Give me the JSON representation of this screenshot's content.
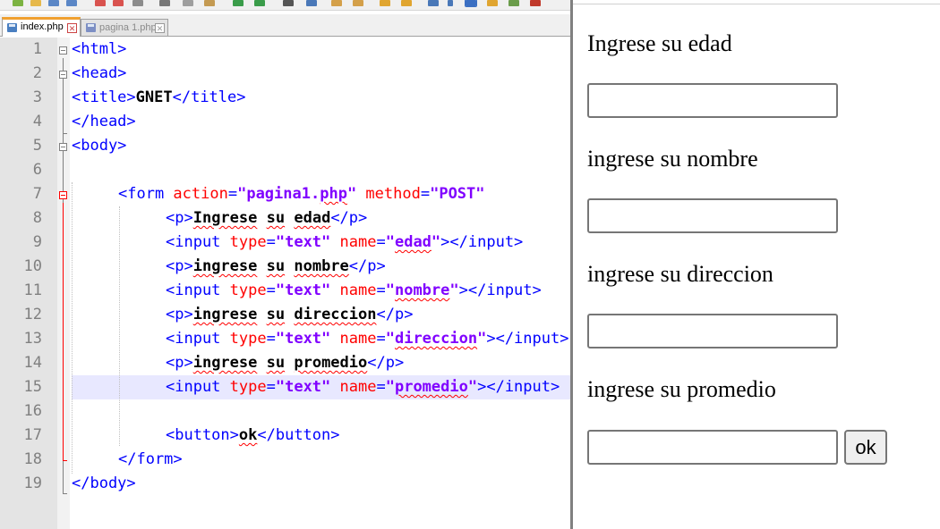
{
  "editor": {
    "tabs": [
      {
        "label": "index.php",
        "active": true
      },
      {
        "label": "pagina 1.php",
        "active": false
      }
    ],
    "close_glyph": "✕",
    "line_numbers": [
      "1",
      "2",
      "3",
      "4",
      "5",
      "6",
      "7",
      "8",
      "9",
      "10",
      "11",
      "12",
      "13",
      "14",
      "15",
      "16",
      "17",
      "18",
      "19"
    ],
    "current_line": "15",
    "code": {
      "l1_tag": "<html>",
      "l2_tag": "<head>",
      "l3_open": "<title>",
      "l3_text": "GNET",
      "l3_close": "</title>",
      "l4_tag": "</head>",
      "l5_tag": "<body>",
      "l7_open": "<form",
      "l7_attr1": " action",
      "l7_eq1": "=",
      "l7_val1a": "\"pagina1.",
      "l7_val1b": "php",
      "l7_val1c": "\"",
      "l7_attr2": " method",
      "l7_eq2": "=",
      "l7_val2": "\"POST\"",
      "l8_open": "<p>",
      "l8_w1": "Ingrese",
      "l8_w2": "su",
      "l8_w3": "edad",
      "l8_close": "</p>",
      "l9_open": "<input",
      "l9_attr1": " type",
      "l9_eq1": "=",
      "l9_val1": "\"text\"",
      "l9_attr2": " name",
      "l9_eq2": "=",
      "l9_q1": "\"",
      "l9_val2": "edad",
      "l9_q2": "\"",
      "l9_close": "></input>",
      "l10_open": "<p>",
      "l10_w1": "ingrese",
      "l10_w2": "su",
      "l10_w3": "nombre",
      "l10_close": "</p>",
      "l11_open": "<input",
      "l11_attr1": " type",
      "l11_eq1": "=",
      "l11_val1": "\"text\"",
      "l11_attr2": " name",
      "l11_eq2": "=",
      "l11_q1": "\"",
      "l11_val2": "nombre",
      "l11_q2": "\"",
      "l11_close": "></input>",
      "l12_open": "<p>",
      "l12_w1": "ingrese",
      "l12_w2": "su",
      "l12_w3": "direccion",
      "l12_close": "</p>",
      "l13_open": "<input",
      "l13_attr1": " type",
      "l13_eq1": "=",
      "l13_val1": "\"text\"",
      "l13_attr2": " name",
      "l13_eq2": "=",
      "l13_q1": "\"",
      "l13_val2": "direccion",
      "l13_q2": "\"",
      "l13_close": "></input>",
      "l14_open": "<p>",
      "l14_w1": "ingrese",
      "l14_w2": "su",
      "l14_w3": "promedio",
      "l14_close": "</p>",
      "l15_open": "<input",
      "l15_attr1": " type",
      "l15_eq1": "=",
      "l15_val1": "\"text\"",
      "l15_attr2": " name",
      "l15_eq2": "=",
      "l15_q1": "\"",
      "l15_val2": "promedio",
      "l15_q2": "\"",
      "l15_close": "></input>",
      "l17_open": "<button>",
      "l17_text": "ok",
      "l17_close": "</button>",
      "l18_tag": "</form>",
      "l19_tag": "</body>"
    },
    "colors": {
      "tag": "#0000ff",
      "attribute": "#ff0000",
      "value": "#8000ff",
      "text": "#000000",
      "current_line_bg": "#e8e8ff",
      "tab_accent": "#f0a030"
    }
  },
  "preview": {
    "labels": [
      "Ingrese su edad",
      "ingrese su nombre",
      "ingrese su direccion",
      "ingrese su promedio"
    ],
    "inputs": [
      {
        "name": "edad",
        "value": ""
      },
      {
        "name": "nombre",
        "value": ""
      },
      {
        "name": "direccion",
        "value": ""
      },
      {
        "name": "promedio",
        "value": ""
      }
    ],
    "button_label": "ok"
  }
}
